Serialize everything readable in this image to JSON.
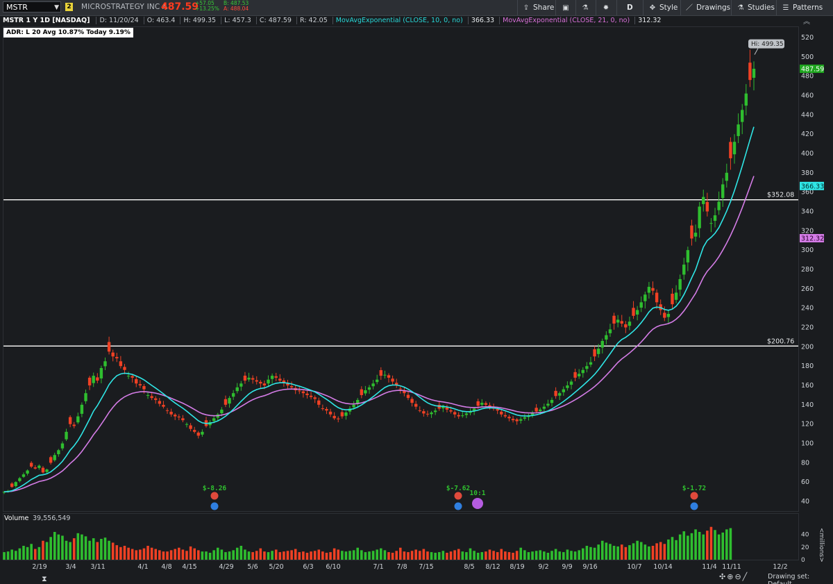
{
  "toolbar": {
    "symbol": "MSTR",
    "link_badge": "2",
    "company": "MICROSTRATEGY INC A",
    "last": "487.59",
    "net_change": "+57.05",
    "pct_change": "+13.25%",
    "bid": "B: 487.53",
    "ask": "A: 488.04",
    "buttons": {
      "share": "Share",
      "style": "Style",
      "drawings": "Drawings",
      "studies": "Studies",
      "patterns": "Patterns",
      "period": "D"
    }
  },
  "info": {
    "title": "MSTR 1 Y 1D [NASDAQ]",
    "date": "D: 11/20/24",
    "open": "O: 463.4",
    "high": "H: 499.35",
    "low": "L: 457.3",
    "close": "C: 487.59",
    "range": "R: 42.05",
    "ema10_label": "MovAvgExponential (CLOSE, 10, 0, no)",
    "ema10_value": "366.33",
    "ema21_label": "MovAvgExponential (CLOSE, 21, 0, no)",
    "ema21_value": "312.32"
  },
  "adr": "ADR: L 20  Avg 10.87%  Today 9.19%",
  "volume": {
    "label": "Volume",
    "value": "39,556,549",
    "units": "<millions>"
  },
  "footer": {
    "drawing_set": "Drawing set: Default"
  },
  "colors": {
    "up": "#2fbe2f",
    "down": "#f04124",
    "ema10": "#2fe6e6",
    "ema21": "#d47ce6",
    "hline": "#ffffff",
    "bg": "#1a1c1f"
  },
  "chart_data": {
    "type": "candlestick",
    "symbol": "MSTR",
    "timeframe": "1Y 1D",
    "yaxis": {
      "ticks": [
        40,
        60,
        80,
        100,
        120,
        140,
        160,
        180,
        200,
        220,
        240,
        260,
        280,
        300,
        320,
        340,
        360,
        380,
        400,
        420,
        440,
        460,
        480,
        500,
        520
      ],
      "range": [
        30,
        530
      ]
    },
    "xaxis": {
      "labels": [
        "2/19",
        "3/4",
        "3/11",
        "4/1",
        "4/8",
        "4/15",
        "4/29",
        "5/6",
        "5/20",
        "6/3",
        "6/10",
        "7/1",
        "7/8",
        "7/15",
        "8/5",
        "8/12",
        "8/19",
        "9/2",
        "9/9",
        "9/16",
        "10/7",
        "10/14",
        "11/4",
        "11/11",
        "12/2"
      ]
    },
    "high_marker": "Hi: 499.35",
    "price_tag": "487.59",
    "ema10_tag": "366.33",
    "ema21_tag": "312.32",
    "hlines": [
      {
        "label": "$352.08",
        "value": 352.08
      },
      {
        "label": "$200.76",
        "value": 200.76
      }
    ],
    "earnings": [
      {
        "label": "$-8.26",
        "date": "4/29"
      },
      {
        "label": "$-7.62",
        "date": "8/1"
      },
      {
        "label": "$-1.72",
        "date": "10/30"
      }
    ],
    "split": {
      "label": "10:1",
      "date": "8/7"
    },
    "volume_axis": [
      0,
      20,
      40
    ],
    "closes": [
      50,
      51,
      55,
      60,
      64,
      68,
      72,
      76,
      74,
      77,
      70,
      73,
      80,
      88,
      93,
      100,
      112,
      120,
      118,
      128,
      140,
      152,
      160,
      170,
      165,
      178,
      185,
      195,
      190,
      188,
      180,
      176,
      170,
      168,
      162,
      160,
      156,
      150,
      147,
      145,
      141,
      138,
      134,
      130,
      128,
      127,
      124,
      120,
      115,
      112,
      108,
      112,
      118,
      122,
      126,
      130,
      135,
      140,
      147,
      152,
      158,
      162,
      165,
      168,
      166,
      164,
      162,
      160,
      166,
      170,
      168,
      165,
      163,
      160,
      158,
      155,
      154,
      152,
      150,
      148,
      146,
      140,
      136,
      134,
      130,
      126,
      125,
      128,
      132,
      136,
      140,
      145,
      150,
      155,
      158,
      162,
      166,
      170,
      171,
      168,
      164,
      160,
      156,
      152,
      147,
      142,
      138,
      134,
      131,
      130,
      132,
      134,
      136,
      138,
      135,
      133,
      130,
      128,
      129,
      131,
      133,
      136,
      139,
      142,
      140,
      138,
      136,
      134,
      130,
      128,
      126,
      124,
      123,
      125,
      127,
      129,
      131,
      133,
      135,
      138,
      141,
      145,
      149,
      152,
      156,
      160,
      164,
      168,
      172,
      176,
      180,
      184,
      190,
      198,
      206,
      212,
      218,
      224,
      228,
      224,
      220,
      226,
      232,
      238,
      246,
      254,
      262,
      258,
      246,
      238,
      230,
      234,
      244,
      256,
      270,
      285,
      300,
      312,
      318,
      345,
      355,
      340,
      328,
      336,
      350,
      368,
      380,
      395,
      412,
      430,
      445,
      462,
      476,
      487.59
    ],
    "volumes": [
      12,
      13,
      16,
      14,
      18,
      22,
      20,
      25,
      17,
      20,
      30,
      28,
      36,
      44,
      40,
      38,
      30,
      28,
      34,
      42,
      40,
      37,
      30,
      34,
      28,
      33,
      35,
      30,
      27,
      23,
      20,
      22,
      19,
      17,
      15,
      16,
      18,
      22,
      19,
      17,
      15,
      13,
      13,
      15,
      17,
      19,
      16,
      14,
      21,
      18,
      15,
      13,
      13,
      11,
      15,
      19,
      16,
      12,
      13,
      15,
      19,
      22,
      16,
      13,
      12,
      14,
      18,
      13,
      12,
      14,
      16,
      12,
      13,
      14,
      15,
      17,
      12,
      13,
      11,
      13,
      14,
      16,
      13,
      11,
      12,
      18,
      16,
      14,
      13,
      14,
      15,
      19,
      15,
      12,
      13,
      14,
      16,
      18,
      15,
      12,
      11,
      14,
      19,
      13,
      12,
      14,
      16,
      14,
      17,
      13,
      12,
      11,
      12,
      14,
      11,
      13,
      15,
      17,
      13,
      12,
      18,
      14,
      11,
      12,
      13,
      16,
      14,
      12,
      17,
      13,
      12,
      11,
      14,
      19,
      15,
      12,
      13,
      14,
      15,
      13,
      11,
      14,
      17,
      13,
      12,
      16,
      14,
      13,
      15,
      18,
      22,
      20,
      19,
      24,
      30,
      27,
      25,
      22,
      21,
      24,
      20,
      23,
      26,
      30,
      28,
      24,
      21,
      22,
      26,
      28,
      25,
      32,
      36,
      31,
      40,
      45,
      38,
      42,
      48,
      44,
      40,
      46,
      52,
      47,
      40,
      43,
      48,
      50
    ]
  }
}
